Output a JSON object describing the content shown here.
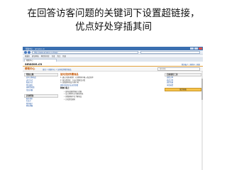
{
  "caption": {
    "line1": "在回答访客问题的关键词下设置超链接，",
    "line2": "优点好处穿插其间"
  },
  "browser": {
    "window_title": "帮助中心 - amazon.cn",
    "address": "http://www.amazon.cn/help/",
    "bookmarks": [
      "收藏夹",
      "建议网站",
      "网页快讯库",
      "百度",
      "淘宝",
      "新浪"
    ],
    "tab_label": "帮助中心"
  },
  "site": {
    "logo": "amazon.cn",
    "header_links": "我的帐户 | 购物车 | 帮助",
    "help_title": "帮助中心",
    "breadcrumb": "首页 > 帮助中心 > 如何找到所需商品",
    "search_placeholder": "搜索帮助"
  },
  "left_panel": {
    "title": "帮助主题",
    "links": [
      "如何订购商品",
      "支付方式",
      "配送方式",
      "售后服务",
      "退换货政策",
      "常见问题"
    ],
    "title2": "其他帮助",
    "links2": [
      "联系我们",
      "礼品卡",
      "我的帐户",
      "网站地图"
    ]
  },
  "main": {
    "heading": "如何找到所需商品",
    "lines": [
      "1. 通过关键词搜索：在搜索框中输入商品名称",
      "2. 按分类浏览：点击左侧商品分类",
      "3. 查看推荐商品与排行榜",
      "更多信息请点击这里查看"
    ],
    "subheading": "购物小贴士",
    "tips": [
      "• 使用高级搜索缩小范围",
      "• 加入购物车后可继续浏览",
      "• 查看顾客评论了解商品",
      "• 订阅到货通知"
    ]
  },
  "right_panel": {
    "title": "自助服务工具",
    "links": [
      "查看订单",
      "修改订单",
      "追踪包裹",
      "申请退货"
    ],
    "button": "联系客服"
  }
}
